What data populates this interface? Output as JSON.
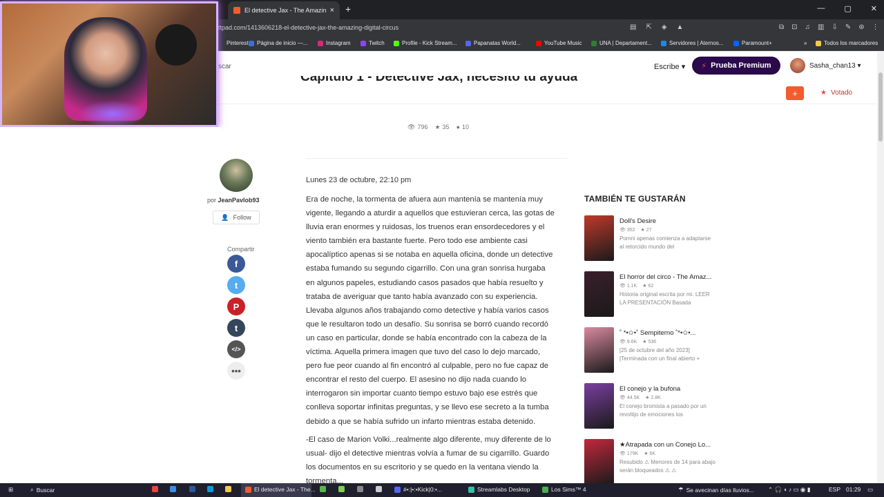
{
  "browser": {
    "tab_title": "El detective Jax - The Amazing D",
    "url": "ttpad.com/1413606218-el-detective-jax-the-amazing-digital-circus",
    "new_tab": "+",
    "close_tab": "×",
    "window_controls": [
      "—",
      "▢",
      "✕"
    ],
    "address_icons": [
      "▤",
      "⇱",
      "◈",
      "▲"
    ],
    "address_icons_right": [
      "⧉",
      "⊡",
      "♫",
      "▥",
      "⇩",
      "✎",
      "⊛",
      "⋮"
    ],
    "bookmarks": [
      {
        "label": "Pinterest",
        "color": "#35363a"
      },
      {
        "label": "Página de inicio —...",
        "color": "#3a6fd8"
      },
      {
        "label": "Instagram",
        "color": "#d6297a"
      },
      {
        "label": "Twitch",
        "color": "#8c44f7"
      },
      {
        "label": "Profile - Kick Stream...",
        "color": "#53fc18"
      },
      {
        "label": "Papanatas World...",
        "color": "#5865f2"
      },
      {
        "label": "YouTube Music",
        "color": "#ff0000"
      },
      {
        "label": "UNA | Departament...",
        "color": "#2e7d32"
      },
      {
        "label": "Servidores | Aternos...",
        "color": "#1e88e5"
      },
      {
        "label": "Paramount+",
        "color": "#0064ff"
      },
      {
        "label": "»",
        "color": "#35363a"
      },
      {
        "label": "Todos los marcadores",
        "color": "#f2c94c"
      }
    ]
  },
  "header": {
    "search_fragment": "scar",
    "write_label": "Escribe ▾",
    "premium_label": "Prueba Premium",
    "username": "Sasha_chan13 ▾"
  },
  "chapter": {
    "title": "Capítulo 1 - Detective Jax, necesito tu ayuda",
    "plus_label": "+",
    "voted_label": "Votado",
    "views": "796",
    "votes": "35",
    "comments": "10"
  },
  "author": {
    "prefix": "por",
    "name": "JeanPavlob93",
    "follow_label": "Follow",
    "share_label": "Compartir",
    "share_buttons": [
      {
        "name": "facebook",
        "glyph": "f",
        "color": "#3b5998"
      },
      {
        "name": "twitter",
        "glyph": "t",
        "color": "#55acee"
      },
      {
        "name": "pinterest",
        "glyph": "P",
        "color": "#cb2027"
      },
      {
        "name": "tumblr",
        "glyph": "t",
        "color": "#35465c"
      },
      {
        "name": "embed",
        "glyph": "</>",
        "color": "#555555"
      },
      {
        "name": "more",
        "glyph": "•••",
        "color": "#eeeeee"
      }
    ]
  },
  "story": {
    "date": "Lunes 23 de octubre, 22:10 pm",
    "paragraphs": [
      "Era de noche, la tormenta de afuera aun mantenía se mantenía muy vigente, llegando a aturdir a aquellos que estuvieran cerca, las gotas de lluvia eran enormes y ruidosas, los truenos eran ensordecedores y el viento también era bastante fuerte. Pero todo ese ambiente casi apocalíptico apenas si se notaba en aquella oficina, donde un detective estaba fumando su segundo cigarrillo. Con una gran sonrisa hurgaba en algunos papeles, estudiando casos pasados que había resuelto y trataba de averiguar que tanto había avanzado con su experiencia. Llevaba algunos años trabajando como detective y había varios casos que le resultaron todo un desafío. Su sonrisa se borró cuando recordó un caso en particular, donde se había encontrado con la cabeza de la víctima. Aquella primera imagen que tuvo del caso lo dejo marcado, pero fue peor cuando al fin encontró al culpable, pero no fue capaz de encontrar el resto del cuerpo. El asesino no dijo nada cuando lo interrogaron sin importar cuanto tiempo estuvo bajo ese estrés que conlleva soportar infinitas preguntas, y se llevo ese secreto a la tumba debido a que se había sufrido un infarto mientras estaba detenido.",
      "-El caso de Marion Volki...realmente algo diferente, muy diferente de lo usual- dijo el detective mientras volvía a fumar de su cigarrillo. Guardo los documentos en su escritorio y se quedo en la ventana viendo la tormenta..."
    ]
  },
  "recommendations": {
    "title": "TAMBIÉN TE GUSTARÁN",
    "items": [
      {
        "title": "Doll's Desire",
        "views": "352",
        "votes": "27",
        "desc": "Pomni apenas comienza a adaptarse al retorcido mundo del",
        "color": "#c0392b"
      },
      {
        "title": "El horror del circo - The Amaz...",
        "views": "1.1K",
        "votes": "62",
        "desc": "Historia original escrita por mi. LEER LA PRESENTACIÓN Basada",
        "color": "#3a1f2b"
      },
      {
        "title": "˚ *•✩•˚ Sempiterno ˚*•✩•...",
        "views": "9.6K",
        "votes": "536",
        "desc": "[25 de octubre del año 2023] [Terminada con un final abierto +",
        "color": "#d98aa0"
      },
      {
        "title": "El conejo y la bufona",
        "views": "44.5K",
        "votes": "2.8K",
        "desc": "El conejo bromista a pasado por un revoltijo de emociones los",
        "color": "#7b3fa0"
      },
      {
        "title": "★Atrapada con un Conejo Lo...",
        "views": "179K",
        "votes": "6K",
        "desc": "Resubido ⚠ Menores de 14 para abajo serán bloqueados ⚠ ⚠",
        "color": "#c2283c"
      }
    ]
  },
  "taskbar": {
    "search_label": "Buscar",
    "browser_task": "El detective Jax - The...",
    "kick_task": "#•:|•:•Kick|0:•...",
    "streamlabs_task": "Streamlabs Desktop",
    "sims_task": "Los Sims™ 4",
    "weather": "Se avecinan días lluvios...",
    "lang": "ESP",
    "time": "01:29"
  },
  "colors": {
    "accent": "#f35c2c",
    "premium_bg": "#2a0a4a",
    "webcam_border": "#d7b5ff"
  }
}
